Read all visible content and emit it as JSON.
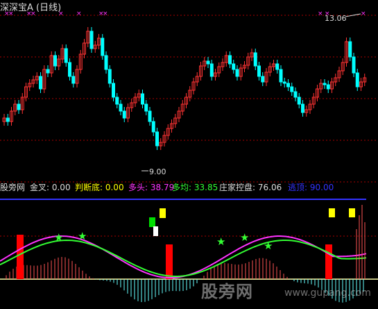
{
  "header": {
    "title": "深深宝A (日线)"
  },
  "price_labels": {
    "high": "13.06",
    "low": "9.00"
  },
  "indicator": {
    "name": "股旁网",
    "items": [
      {
        "label": "金叉: 0.00",
        "color": "#dddddd"
      },
      {
        "label": "判断底: 0.00",
        "color": "#ffff00"
      },
      {
        "label": "多头: 38.79",
        "color": "#ff33ff"
      },
      {
        "label": "多均: 33.85",
        "color": "#33ff33"
      },
      {
        "label": "庄家控盘: 76.06",
        "color": "#dddddd"
      },
      {
        "label": "逃顶: 90.00",
        "color": "#3333ff"
      }
    ]
  },
  "watermark": {
    "main": "股旁网",
    "sub": "www.gupang.com"
  },
  "colors": {
    "up": "#ff3333",
    "down": "#00ffff",
    "grid": "#aa0000",
    "duotou": "#ff33ff",
    "duojun": "#33ff33",
    "taoding": "#3333ff"
  }
}
